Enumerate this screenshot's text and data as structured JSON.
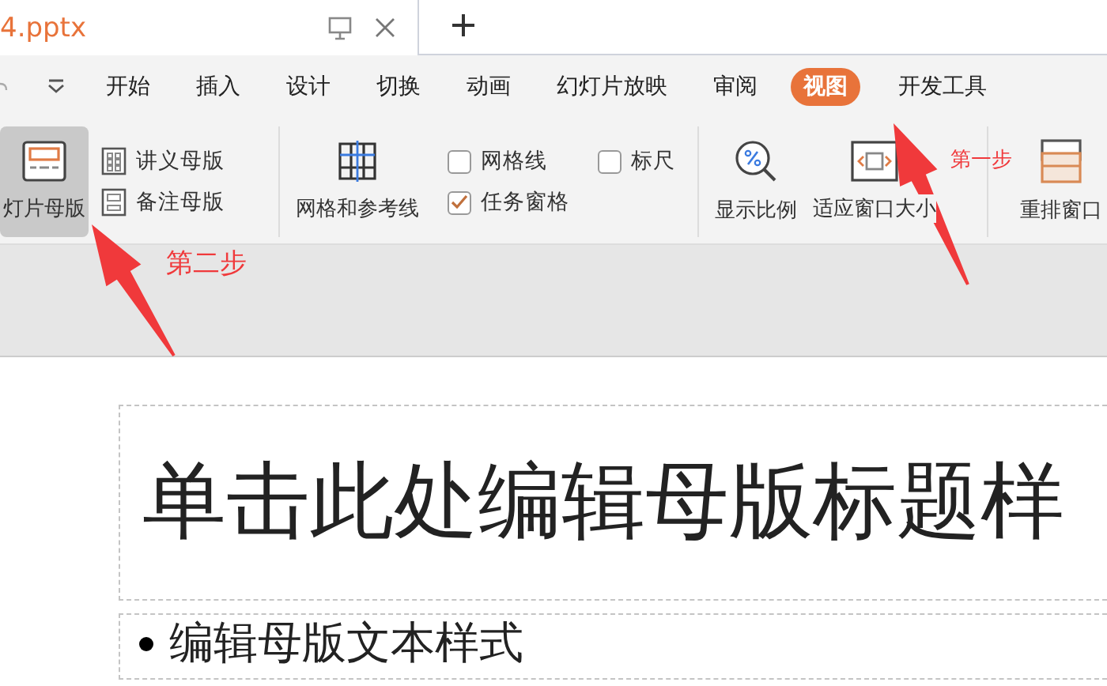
{
  "document_tab": {
    "title": "4.pptx"
  },
  "menu_tabs": [
    {
      "label": "开始",
      "selected": false
    },
    {
      "label": "插入",
      "selected": false
    },
    {
      "label": "设计",
      "selected": false
    },
    {
      "label": "切换",
      "selected": false
    },
    {
      "label": "动画",
      "selected": false
    },
    {
      "label": "幻灯片放映",
      "selected": false
    },
    {
      "label": "审阅",
      "selected": false
    },
    {
      "label": "视图",
      "selected": true
    },
    {
      "label": "开发工具",
      "selected": false
    }
  ],
  "ribbon": {
    "groups": [
      {
        "items": [
          {
            "kind": "large",
            "label": "灯片母版",
            "selected": true
          },
          {
            "kind": "small",
            "label": "讲义母版"
          },
          {
            "kind": "small",
            "label": "备注母版"
          }
        ]
      },
      {
        "items": [
          {
            "kind": "large",
            "label": "网格和参考线",
            "selected": false
          },
          {
            "kind": "checkbox",
            "label": "网格线",
            "checked": false
          },
          {
            "kind": "checkbox",
            "label": "任务窗格",
            "checked": true
          },
          {
            "kind": "checkbox",
            "label": "标尺",
            "checked": false
          }
        ]
      },
      {
        "items": [
          {
            "kind": "large",
            "label": "显示比例",
            "selected": false
          },
          {
            "kind": "large",
            "label": "适应窗口大小",
            "selected": false
          }
        ]
      },
      {
        "items": [
          {
            "kind": "large",
            "label": "重排窗口",
            "selected": false
          }
        ]
      }
    ]
  },
  "slide": {
    "title_placeholder": "单击此处编辑母版标题样",
    "body_placeholder": "编辑母版文本样式"
  },
  "annotations": [
    {
      "text": "第一步"
    },
    {
      "text": "第二步"
    }
  ]
}
